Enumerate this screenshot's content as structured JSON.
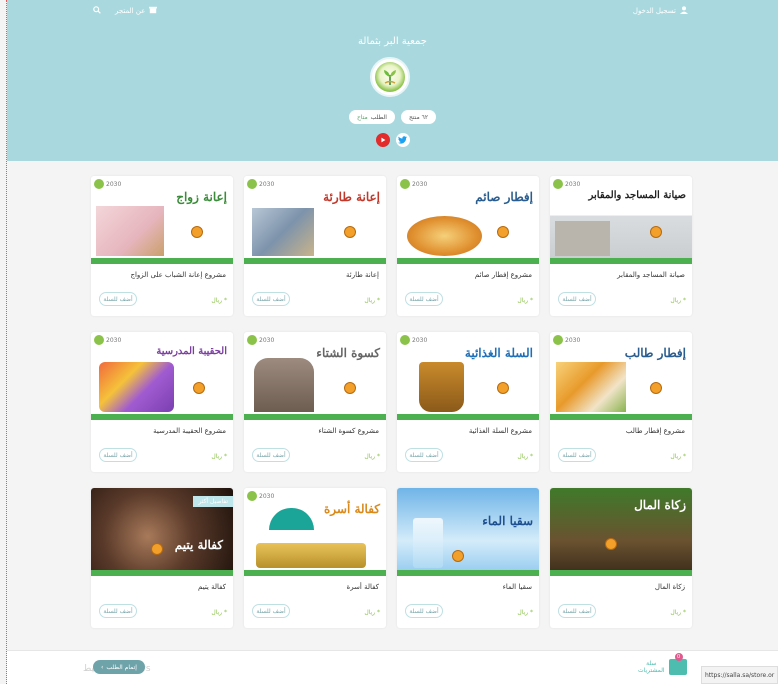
{
  "header": {
    "login_label": "تسجيل الدخول",
    "about_label": "عن المتجر",
    "store_name": "جمعية البر بثمالة",
    "pill_products": "٦٢ منتج",
    "pill_orders_label": "الطلب",
    "pill_orders_value": "متاح",
    "colors": {
      "bg": "#a9d9df",
      "accent": "#4caf50"
    }
  },
  "products": [
    {
      "name": "صيانة المساجد والمقابر",
      "art_title": "صيانة المساجد والمقابر",
      "price": "* ريال",
      "add": "أضف للسلة",
      "art_color": "#222"
    },
    {
      "name": "مشروع إفطار صائم",
      "art_title": "إفطار صائم",
      "price": "* ريال",
      "add": "أضف للسلة",
      "art_color": "#2a5d8f"
    },
    {
      "name": "إعانة طارئة",
      "art_title": "إعانة طارئة",
      "price": "* ريال",
      "add": "أضف للسلة",
      "art_color": "#c0392b"
    },
    {
      "name": "مشروع إعانة الشباب على الزواج",
      "art_title": "إعانة زواج",
      "price": "* ريال",
      "add": "أضف للسلة",
      "art_color": "#3a8c3a"
    },
    {
      "name": "مشروع إفطار طالب",
      "art_title": "إفطار طالب",
      "price": "* ريال",
      "add": "أضف للسلة",
      "art_color": "#2a5d8f"
    },
    {
      "name": "مشروع السلة الغذائية",
      "art_title": "السلة الغذائية",
      "price": "* ريال",
      "add": "أضف للسلة",
      "art_color": "#1e6fb8"
    },
    {
      "name": "مشروع كسوة الشتاء",
      "art_title": "كسوة الشتاء",
      "price": "* ريال",
      "add": "أضف للسلة",
      "art_color": "#666"
    },
    {
      "name": "مشروع الحقيبة المدرسية",
      "art_title": "الحقيبة المدرسية",
      "price": "* ريال",
      "add": "أضف للسلة",
      "art_color": "#7b3fa0"
    },
    {
      "name": "زكاة المال",
      "art_title": "زكاة المال",
      "price": "* ريال",
      "add": "أضف للسلة",
      "art_color": "#fff"
    },
    {
      "name": "سقيا الماء",
      "art_title": "سقيا الماء",
      "price": "* ريال",
      "add": "أضف للسلة",
      "art_color": "#1e4f8f"
    },
    {
      "name": "كفالة أسرة",
      "art_title": "كفالة أسرة",
      "price": "* ريال",
      "add": "أضف للسلة",
      "art_color": "#d98a1a"
    },
    {
      "name": "كفالة يتيم",
      "art_title": "كفالة يتيم",
      "price": "* ريال",
      "add": "أضف للسلة",
      "art_color": "#fff",
      "tag": "تفاصيل أكثر"
    }
  ],
  "bottom": {
    "complete_order": "إتمام الطلب",
    "cart_label_1": "سلة",
    "cart_label_2": "المشتريات",
    "cart_count": "0",
    "watermark": "تنشيط Windows",
    "status_url": "https://salla.sa/store.or"
  }
}
